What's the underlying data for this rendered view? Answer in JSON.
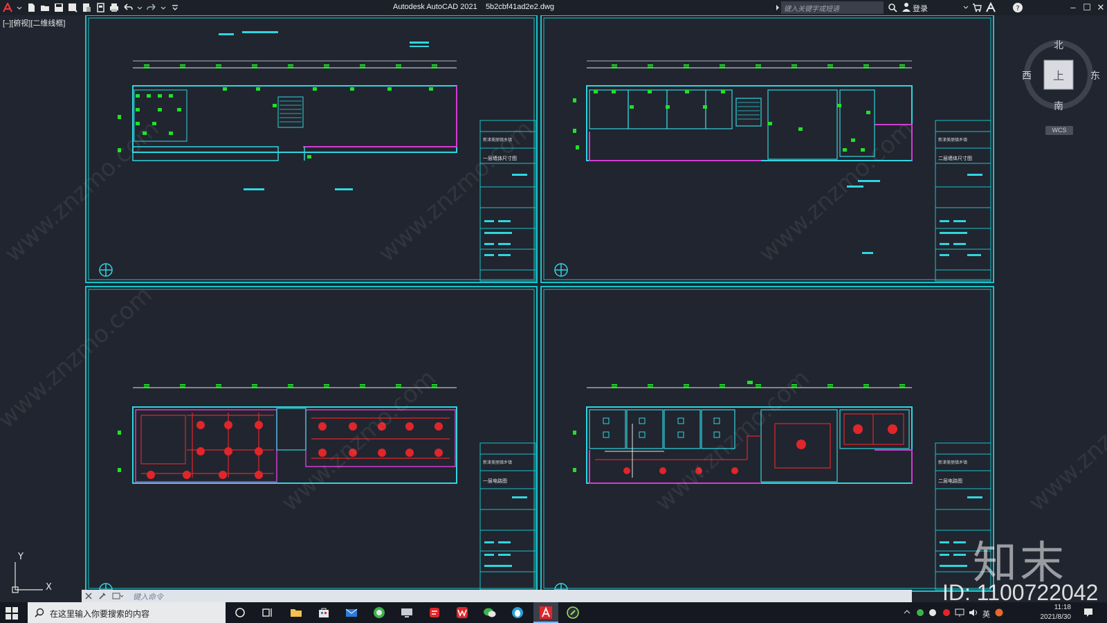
{
  "titlebar": {
    "app_name": "Autodesk AutoCAD 2021",
    "file_name": "5b2cbf41ad2e2.dwg",
    "search_placeholder": "键入关键字或短语",
    "login_label": "登录",
    "minimize_label": "–",
    "maximize_label": "☐",
    "close_label": "✕",
    "accent_color": "#e03a3a"
  },
  "viewport": {
    "label": "[–][俯视][二维线框]"
  },
  "view_cube": {
    "north": "北",
    "south": "南",
    "east": "东",
    "west": "西",
    "top_face": "上",
    "wcs_label": "WCS"
  },
  "ucs": {
    "x_label": "X",
    "y_label": "Y"
  },
  "drawings": [
    {
      "name": "一层墙体尺寸图",
      "project": "新津美丽镇乡镇"
    },
    {
      "name": "二层墙体尺寸图",
      "project": "新津美丽镇乡镇"
    },
    {
      "name": "一层电路图",
      "project": "新津美丽镇乡镇"
    },
    {
      "name": "二层电路图",
      "project": "新津美丽镇乡镇"
    }
  ],
  "command_line": {
    "placeholder": "键入命令"
  },
  "watermark": {
    "site": "www.znzmo.com",
    "brand": "知末网",
    "logo": "知末",
    "id": "ID: 1100722042"
  },
  "taskbar": {
    "search_placeholder": "在这里输入你要搜索的内容",
    "time": "11:18",
    "date": "2021/8/30",
    "ime_label": "英"
  },
  "colors": {
    "canvas": "#21252f",
    "frame": "#19c3c8",
    "wall": "#2fd6df",
    "dimension_marker": "#22e02a",
    "magenta_line": "#d43bd4",
    "red_circuit": "#e0262a"
  }
}
